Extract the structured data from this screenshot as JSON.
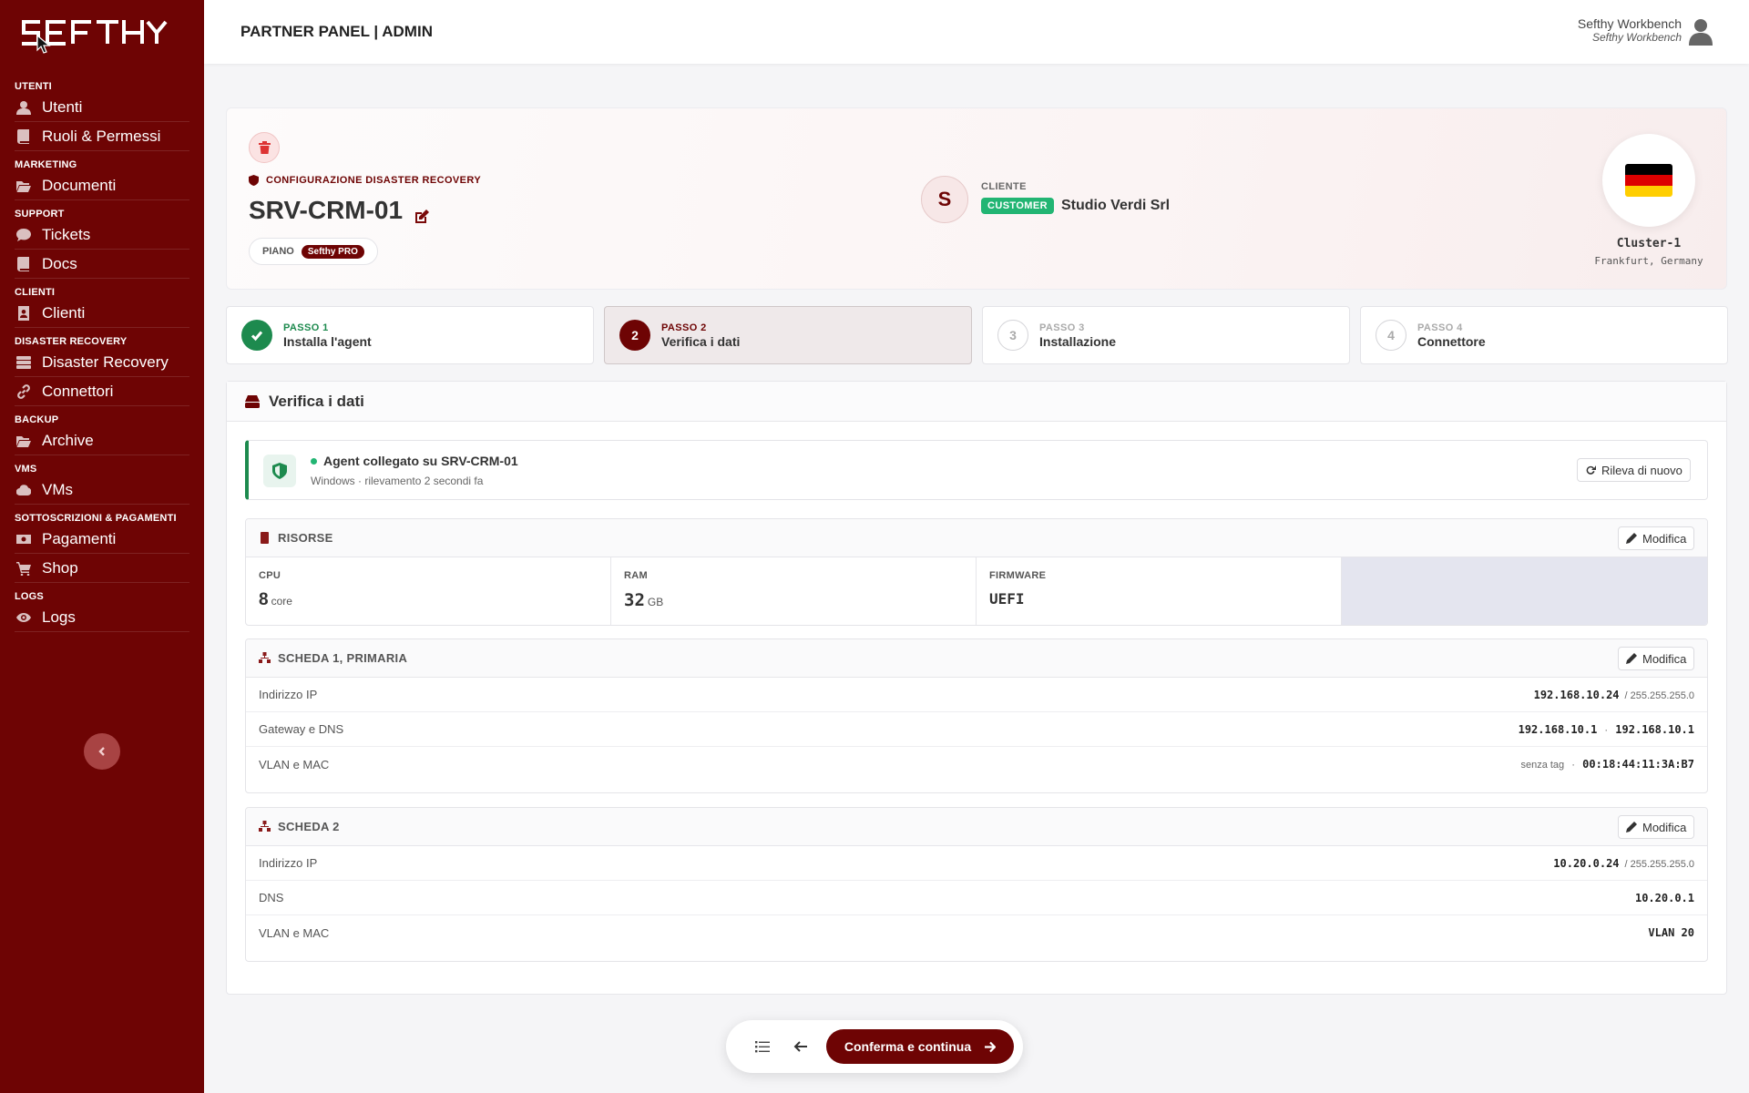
{
  "brand": {
    "logo_text": "SEFTHY",
    "accent": "#6e0404"
  },
  "sidebar": {
    "sections": [
      {
        "title": "UTENTI",
        "items": [
          {
            "label": "Utenti",
            "icon": "user-icon"
          },
          {
            "label": "Ruoli & Permessi",
            "icon": "book-icon"
          }
        ]
      },
      {
        "title": "MARKETING",
        "items": [
          {
            "label": "Documenti",
            "icon": "folder-open-icon"
          }
        ]
      },
      {
        "title": "SUPPORT",
        "items": [
          {
            "label": "Tickets",
            "icon": "comment-icon"
          },
          {
            "label": "Docs",
            "icon": "book-icon"
          }
        ]
      },
      {
        "title": "CLIENTI",
        "items": [
          {
            "label": "Clienti",
            "icon": "address-book-icon"
          }
        ]
      },
      {
        "title": "DISASTER RECOVERY",
        "items": [
          {
            "label": "Disaster Recovery",
            "icon": "server-icon"
          },
          {
            "label": "Connettori",
            "icon": "link-icon"
          }
        ]
      },
      {
        "title": "BACKUP",
        "items": [
          {
            "label": "Archive",
            "icon": "folder-open-icon"
          }
        ]
      },
      {
        "title": "VMS",
        "items": [
          {
            "label": "VMs",
            "icon": "cloud-icon"
          }
        ]
      },
      {
        "title": "SOTTOSCRIZIONI & PAGAMENTI",
        "items": [
          {
            "label": "Pagamenti",
            "icon": "money-icon"
          },
          {
            "label": "Shop",
            "icon": "cart-icon"
          }
        ]
      },
      {
        "title": "LOGS",
        "items": [
          {
            "label": "Logs",
            "icon": "eye-icon"
          }
        ]
      }
    ]
  },
  "topbar": {
    "title": "PARTNER PANEL | ADMIN",
    "user_name": "Sefthy Workbench",
    "user_sub": "Sefthy Workbench"
  },
  "hero": {
    "eyebrow": "CONFIGURAZIONE DISASTER RECOVERY",
    "title": "SRV-CRM-01",
    "plan_label": "PIANO",
    "plan_badge": "Sefthy PRO",
    "client_initial": "S",
    "client_label": "CLIENTE",
    "client_badge": "CUSTOMER",
    "client_name": "Studio Verdi Srl",
    "cluster_name": "Cluster-1",
    "cluster_location": "Frankfurt, Germany"
  },
  "steps": [
    {
      "label": "PASSO 1",
      "name": "Installa l'agent",
      "state": "done",
      "num": "1"
    },
    {
      "label": "PASSO 2",
      "name": "Verifica i dati",
      "state": "current",
      "num": "2"
    },
    {
      "label": "PASSO 3",
      "name": "Installazione",
      "state": "todo",
      "num": "3"
    },
    {
      "label": "PASSO 4",
      "name": "Connettore",
      "state": "todo",
      "num": "4"
    }
  ],
  "panel": {
    "title": "Verifica i dati",
    "agent": {
      "title": "Agent collegato su SRV-CRM-01",
      "sub": "Windows · rilevamento 2 secondi fa",
      "refresh": "Rileva di nuovo"
    },
    "resources": {
      "title": "RISORSE",
      "edit": "Modifica",
      "cpu_label": "CPU",
      "cpu_value": "8",
      "cpu_unit": "core",
      "ram_label": "RAM",
      "ram_value": "32",
      "ram_unit": "GB",
      "fw_label": "FIRMWARE",
      "fw_value": "UEFI"
    },
    "nic1": {
      "title": "SCHEDA 1, PRIMARIA",
      "edit": "Modifica",
      "ip_label": "Indirizzo IP",
      "ip": "192.168.10.24",
      "mask": "/ 255.255.255.0",
      "gw_label": "Gateway e DNS",
      "gw": "192.168.10.1",
      "gw_sep": "·",
      "dns": "192.168.10.1",
      "vlan_label": "VLAN e MAC",
      "vlan": "senza tag",
      "vlan_sep": "·",
      "mac": "00:18:44:11:3A:B7"
    },
    "nic2": {
      "title": "SCHEDA 2",
      "edit": "Modifica",
      "ip_label": "Indirizzo IP",
      "ip": "10.20.0.24",
      "mask": "/ 255.255.255.0",
      "dns_label": "DNS",
      "dns": "10.20.0.1",
      "vlan_label": "VLAN e MAC",
      "vlan": "VLAN 20"
    }
  },
  "floatbar": {
    "confirm": "Conferma e continua"
  }
}
